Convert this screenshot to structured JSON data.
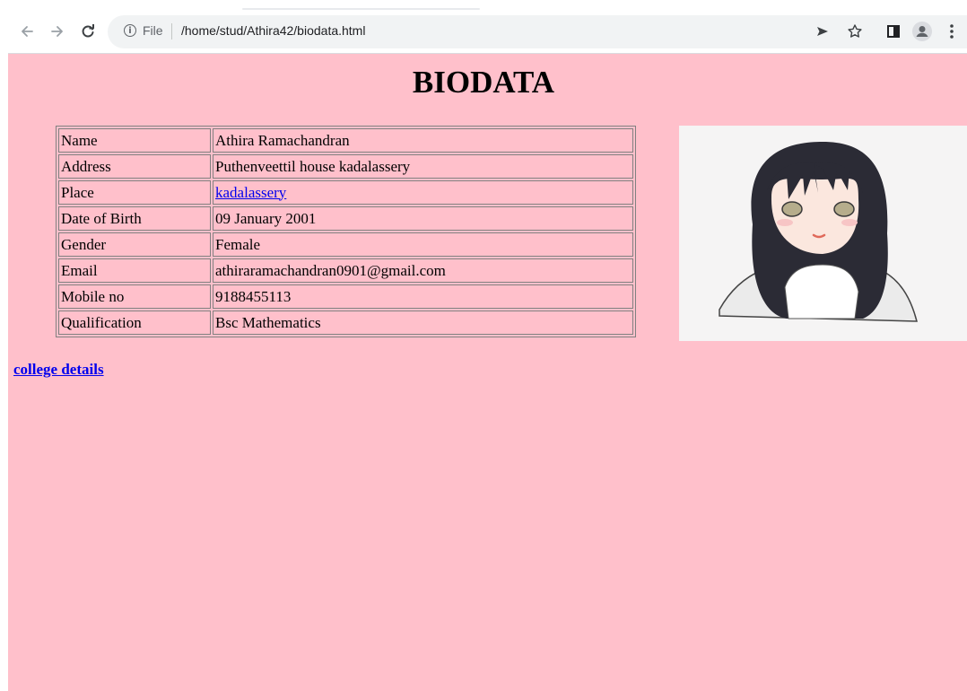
{
  "browser": {
    "file_label": "File",
    "url": "/home/stud/Athira42/biodata.html"
  },
  "page": {
    "title": "BIODATA",
    "rows": [
      {
        "label": "Name",
        "value": "Athira Ramachandran"
      },
      {
        "label": "Address",
        "value": "Puthenveettil house kadalassery"
      },
      {
        "label": "Place",
        "value": "kadalassery"
      },
      {
        "label": "Date of Birth",
        "value": "09 January 2001"
      },
      {
        "label": "Gender",
        "value": "Female"
      },
      {
        "label": "Email",
        "value": "athiraramachandran0901@gmail.com"
      },
      {
        "label": "Mobile no",
        "value": "9188455113"
      },
      {
        "label": "Qualification",
        "value": "Bsc Mathematics"
      }
    ],
    "college_link": "college details"
  },
  "colors": {
    "page_bg": "#ffc0cb",
    "link": "#0000ee"
  },
  "icons": [
    "back-arrow-icon",
    "forward-arrow-icon",
    "reload-icon",
    "info-icon",
    "share-icon",
    "star-icon",
    "side-panel-icon",
    "profile-icon",
    "menu-dots-icon"
  ]
}
